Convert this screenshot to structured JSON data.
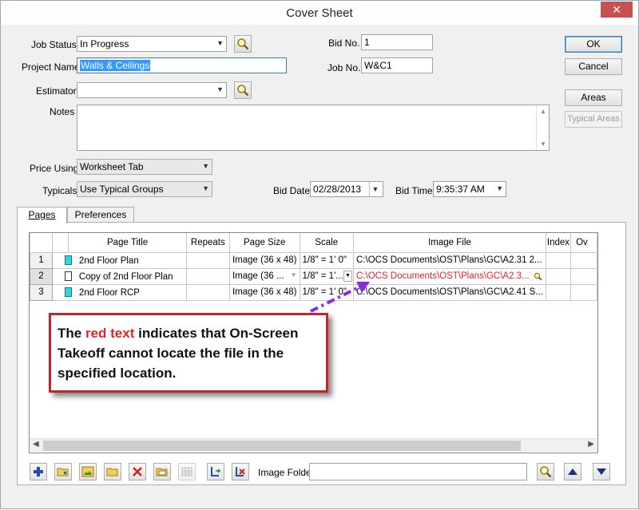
{
  "window": {
    "title": "Cover Sheet",
    "close_glyph": "✕"
  },
  "form": {
    "job_status": {
      "label": "Job Status",
      "value": "In Progress"
    },
    "project_name": {
      "label": "Project Name",
      "value": "Walls & Ceilings"
    },
    "estimator": {
      "label": "Estimator",
      "value": ""
    },
    "notes": {
      "label": "Notes",
      "value": ""
    },
    "bid_no": {
      "label": "Bid No.",
      "value": "1"
    },
    "job_no": {
      "label": "Job No.",
      "value": "W&C1"
    },
    "price_using": {
      "label": "Price Using",
      "value": "Worksheet Tab"
    },
    "typicals": {
      "label": "Typicals",
      "value": "Use Typical Groups"
    },
    "bid_date": {
      "label": "Bid Date",
      "value": "02/28/2013"
    },
    "bid_time": {
      "label": "Bid Time",
      "value": "9:35:37 AM"
    }
  },
  "buttons": {
    "ok": "OK",
    "cancel": "Cancel",
    "areas": "Areas",
    "typical_areas": "Typical Areas"
  },
  "tabs": [
    {
      "label": "Pages",
      "active": true
    },
    {
      "label": "Preferences",
      "active": false
    }
  ],
  "grid": {
    "columns": [
      "",
      "",
      "Page Title",
      "Repeats",
      "Page Size",
      "Scale",
      "Image File",
      "Index",
      "Ov"
    ],
    "rows": [
      {
        "num": "1",
        "title": "2nd Floor Plan",
        "repeats": "",
        "size": "Image (36 x 48)",
        "scale": "1/8\" = 1' 0\"",
        "file": "C:\\OCS Documents\\OST\\Plans\\GC\\A2.31 2...",
        "icon": "cyan",
        "missing": false
      },
      {
        "num": "2",
        "title": "Copy of 2nd Floor Plan",
        "repeats": "",
        "size": "Image (36 ...",
        "scale": "1/8\" = 1'...",
        "file": "C:\\OCS Documents\\OST\\Plans\\GC\\A2.3...",
        "icon": "white",
        "missing": true
      },
      {
        "num": "3",
        "title": "2nd Floor RCP",
        "repeats": "",
        "size": "Image (36 x 48)",
        "scale": "1/8\" = 1' 0\"",
        "file": "C:\\OCS Documents\\OST\\Plans\\GC\\A2.41 S...",
        "icon": "cyan",
        "missing": false
      }
    ]
  },
  "callout": {
    "prefix": "The ",
    "highlight": "red text",
    "suffix": " indicates that On-Screen Takeoff cannot locate the file in the specified location."
  },
  "toolbar": {
    "image_folder_label": "Image Folder",
    "image_folder_value": "",
    "icons": [
      "add-page-icon",
      "open-folder-icon",
      "image-icon",
      "folder-icon",
      "delete-icon",
      "folder-open-icon",
      "grid-icon",
      "move-icon",
      "remove-icon"
    ]
  },
  "colors": {
    "missing_file": "#e0242a",
    "callout_border": "#c0262e",
    "arrow": "#8a2be2",
    "close_button": "#c75050"
  }
}
